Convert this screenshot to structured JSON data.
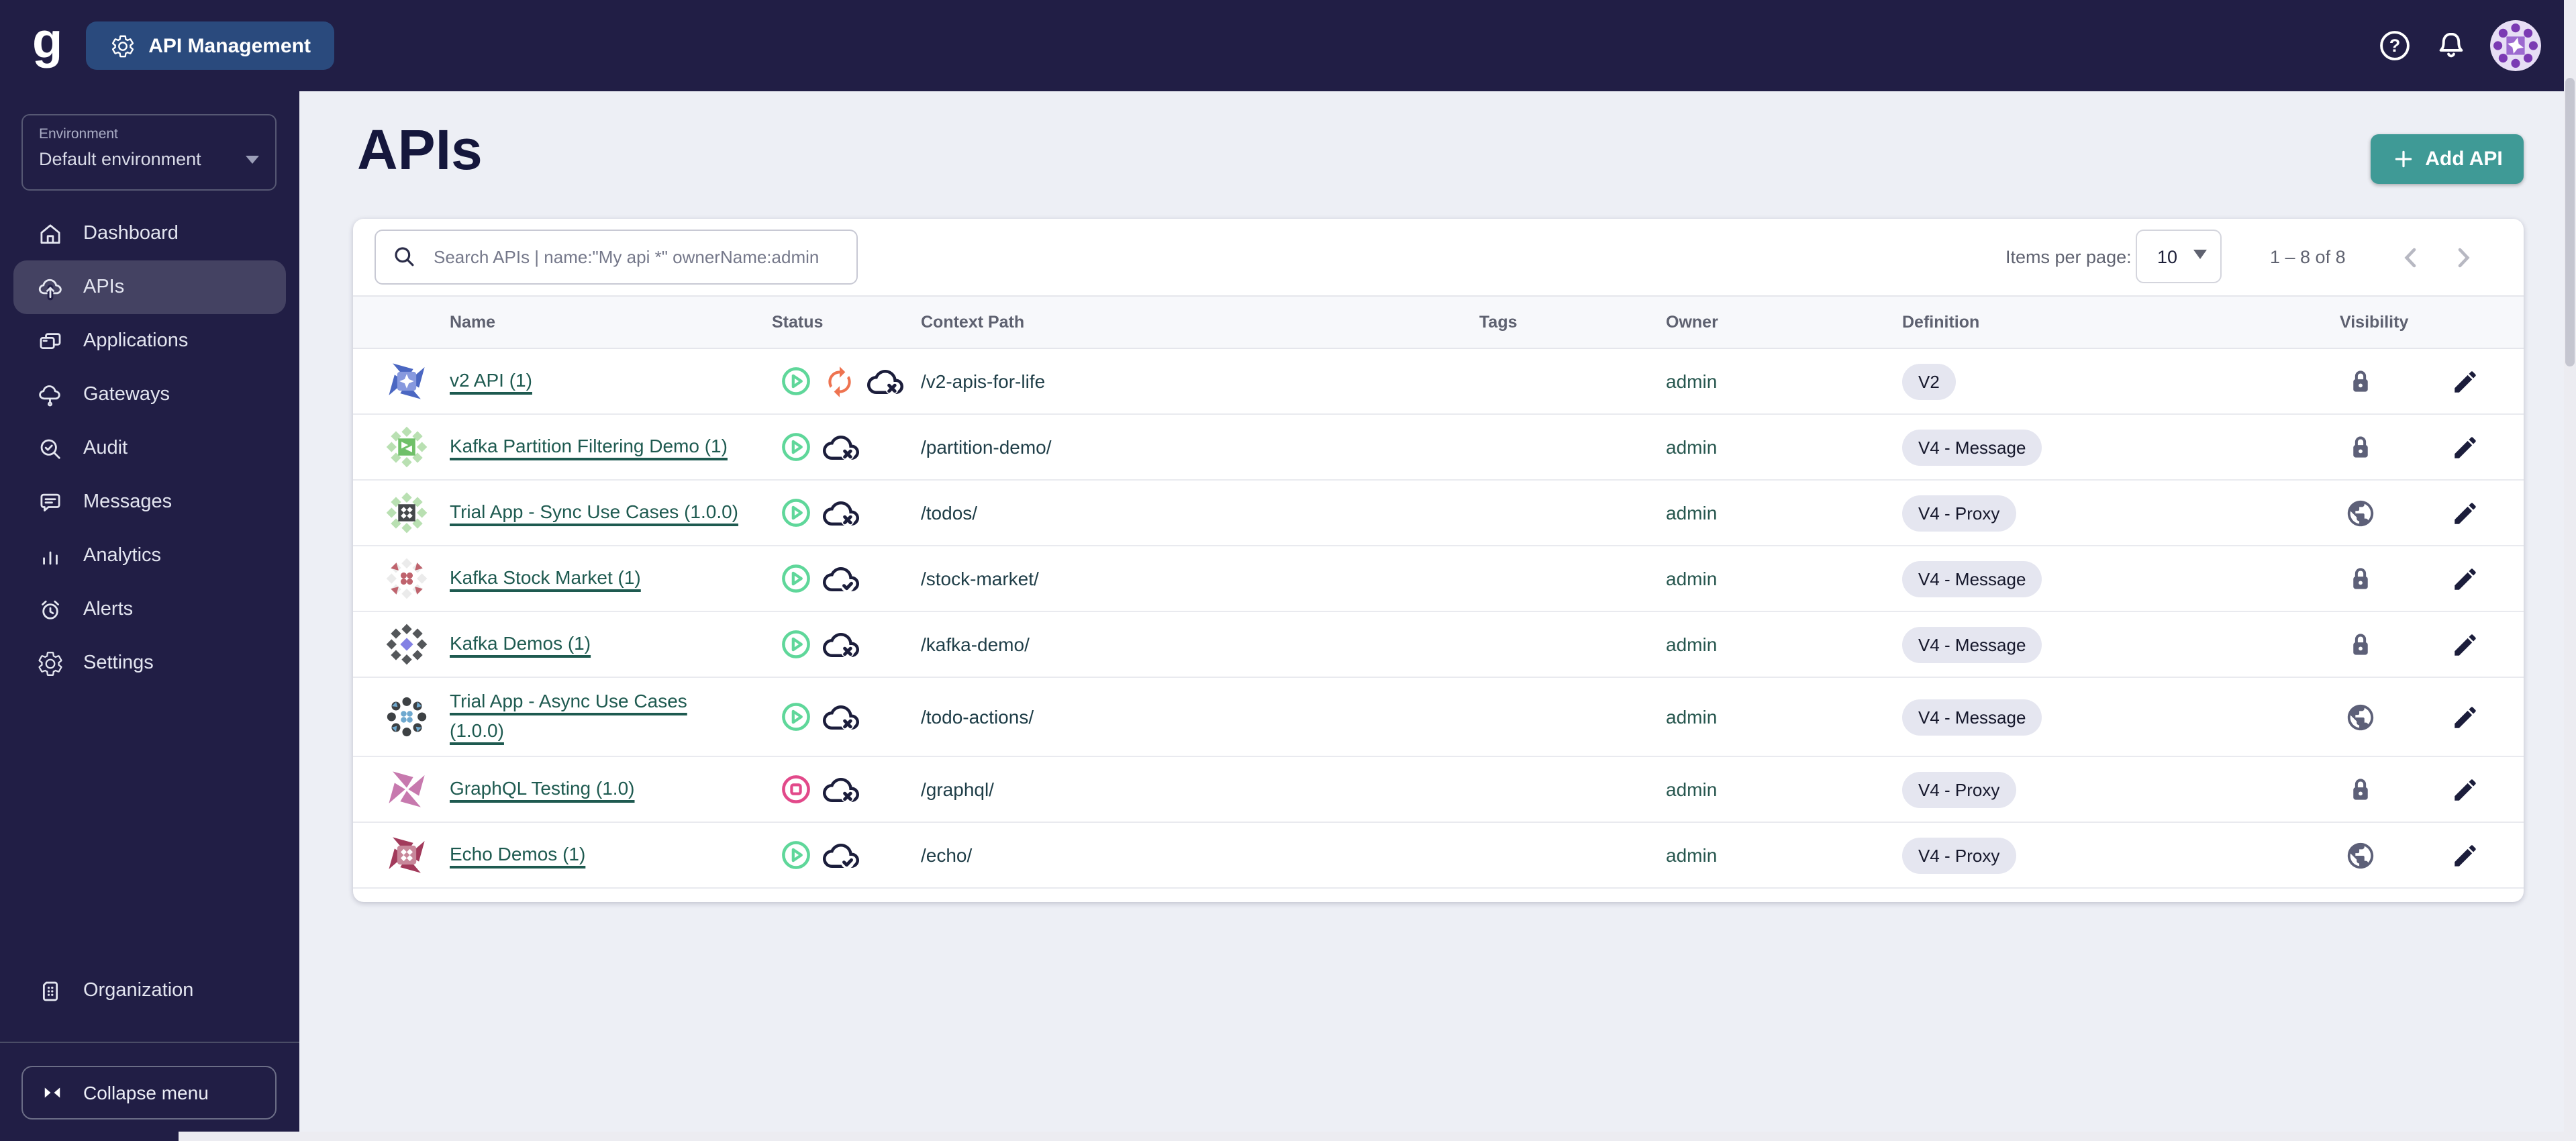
{
  "topbar": {
    "app_label": "API Management"
  },
  "header": {
    "title": "APIs",
    "add_button": "Add API"
  },
  "sidebar": {
    "environment": {
      "label": "Environment",
      "value": "Default environment"
    },
    "items": [
      {
        "label": "Dashboard",
        "icon": "dashboard",
        "active": false
      },
      {
        "label": "APIs",
        "icon": "apis",
        "active": true
      },
      {
        "label": "Applications",
        "icon": "applications",
        "active": false
      },
      {
        "label": "Gateways",
        "icon": "gateways",
        "active": false
      },
      {
        "label": "Audit",
        "icon": "audit",
        "active": false
      },
      {
        "label": "Messages",
        "icon": "messages",
        "active": false
      },
      {
        "label": "Analytics",
        "icon": "analytics",
        "active": false
      },
      {
        "label": "Alerts",
        "icon": "alerts",
        "active": false
      },
      {
        "label": "Settings",
        "icon": "settings",
        "active": false
      }
    ],
    "organization": {
      "label": "Organization",
      "icon": "organization"
    },
    "collapse": {
      "label": "Collapse menu"
    }
  },
  "toolbar": {
    "search_placeholder": "Search APIs | name:\"My api *\" ownerName:admin",
    "items_per_page_label": "Items per page:",
    "items_per_page_value": "10",
    "range": "1 – 8 of 8"
  },
  "table": {
    "columns": {
      "name": "Name",
      "status": "Status",
      "context_path": "Context Path",
      "tags": "Tags",
      "owner": "Owner",
      "definition": "Definition",
      "visibility": "Visibility"
    },
    "rows": [
      {
        "name": "v2 API (1)",
        "status": [
          "started",
          "out-of-sync",
          "cloud-error"
        ],
        "context_path": "/v2-apis-for-life",
        "tags": "",
        "owner": "admin",
        "definition": "V2",
        "visibility": "private",
        "avatar": {
          "type": "pinwheel",
          "center": "star",
          "c1": "#4b67c2",
          "c2": "#8799de"
        }
      },
      {
        "name": "Kafka Partition Filtering Demo (1)",
        "status": [
          "started",
          "cloud-error"
        ],
        "context_path": "/partition-demo/",
        "tags": "",
        "owner": "admin",
        "definition": "V4 - Message",
        "visibility": "private",
        "avatar": {
          "type": "ring",
          "center": "square-tris",
          "c1": "#b9e0b2",
          "c2": "#6fc069"
        }
      },
      {
        "name": "Trial App - Sync Use Cases (1.0.0)",
        "status": [
          "started",
          "cloud-error"
        ],
        "context_path": "/todos/",
        "tags": "",
        "owner": "admin",
        "definition": "V4 - Proxy",
        "visibility": "public",
        "avatar": {
          "type": "ring",
          "center": "square-diamonds",
          "c1": "#b9e0b2",
          "c2": "#45484b"
        }
      },
      {
        "name": "Kafka Stock Market (1)",
        "status": [
          "started",
          "cloud-ok"
        ],
        "context_path": "/stock-market/",
        "tags": "",
        "owner": "admin",
        "definition": "V4 - Message",
        "visibility": "private",
        "avatar": {
          "type": "ring",
          "center": "dots",
          "c1": "#ebebeb",
          "c2": "#bf636d"
        }
      },
      {
        "name": "Kafka Demos (1)",
        "status": [
          "started",
          "cloud-error"
        ],
        "context_path": "/kafka-demo/",
        "tags": "",
        "owner": "admin",
        "definition": "V4 - Message",
        "visibility": "private",
        "avatar": {
          "type": "ring",
          "center": "diamond",
          "c1": "#54575a",
          "c2": "#8381e4"
        }
      },
      {
        "name": "Trial App - Async Use Cases",
        "name_line2": "(1.0.0)",
        "status": [
          "started",
          "cloud-error"
        ],
        "context_path": "/todo-actions/",
        "tags": "",
        "owner": "admin",
        "definition": "V4 - Message",
        "visibility": "public",
        "avatar": {
          "type": "dots",
          "c1": "#3d4144",
          "c2": "#6fa9cf"
        }
      },
      {
        "name": "GraphQL Testing (1.0)",
        "status": [
          "stopped",
          "cloud-error"
        ],
        "context_path": "/graphql/",
        "tags": "",
        "owner": "admin",
        "definition": "V4 - Proxy",
        "visibility": "private",
        "avatar": {
          "type": "pinwheel",
          "center": "none",
          "c1": "#c779ae",
          "c2": ""
        }
      },
      {
        "name": "Echo Demos (1)",
        "status": [
          "started",
          "cloud-ok"
        ],
        "context_path": "/echo/",
        "tags": "",
        "owner": "admin",
        "definition": "V4 - Proxy",
        "visibility": "public",
        "avatar": {
          "type": "pinwheel",
          "center": "diamonds",
          "c1": "#a23a5b",
          "c2": "#c8879a"
        }
      }
    ]
  },
  "colors": {
    "accent_teal": "#3f9a96",
    "status_started": "#5fd79a",
    "status_stopped": "#e2498a",
    "status_out_of_sync": "#ee7350",
    "icon_dark": "#1b1d3b",
    "icon_slate": "#5d6078",
    "navy": "#211e45",
    "chip_blue": "#2a4a7d"
  }
}
